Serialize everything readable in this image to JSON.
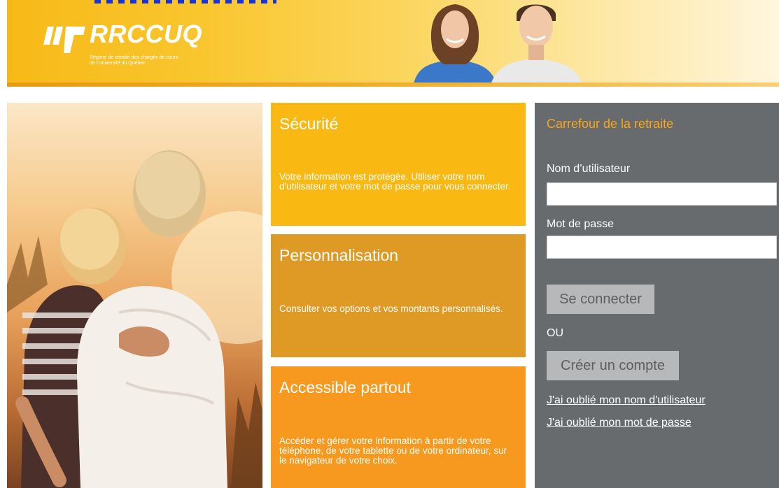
{
  "header": {
    "logo_text": "RRCCUQ",
    "logo_subtitle_line1": "Régime de retraite des chargés de cours",
    "logo_subtitle_line2": "de l'Université du Québec"
  },
  "features": [
    {
      "title": "Sécurité",
      "text": "Votre information est protégée. Utiliser votre nom d'utilisateur et votre mot de passe pour vous connecter."
    },
    {
      "title": "Personnalisation",
      "text": "Consulter vos options et vos montants personnalisés."
    },
    {
      "title": "Accessible partout",
      "text": "Accéder et gérer votre information à partir de votre téléphone, de votre tablette ou de votre ordinateur, sur le navigateur de votre choix."
    }
  ],
  "login": {
    "title": "Carrefour de la retraite",
    "username_label": "Nom d’utilisateur",
    "username_value": "",
    "password_label": "Mot de passe",
    "password_value": "",
    "login_button": "Se connecter",
    "or_text": "OU",
    "create_button": "Créer un compte",
    "forgot_username": "J'ai oublié mon nom d'utilisateur",
    "forgot_password": "J'ai oublié mon mot de passe"
  },
  "colors": {
    "brand_yellow": "#f9b812",
    "tile_mid": "#de9a24",
    "tile_orange": "#f7981f",
    "panel_gray": "#686b6d",
    "panel_title_orange": "#f7a81b"
  }
}
